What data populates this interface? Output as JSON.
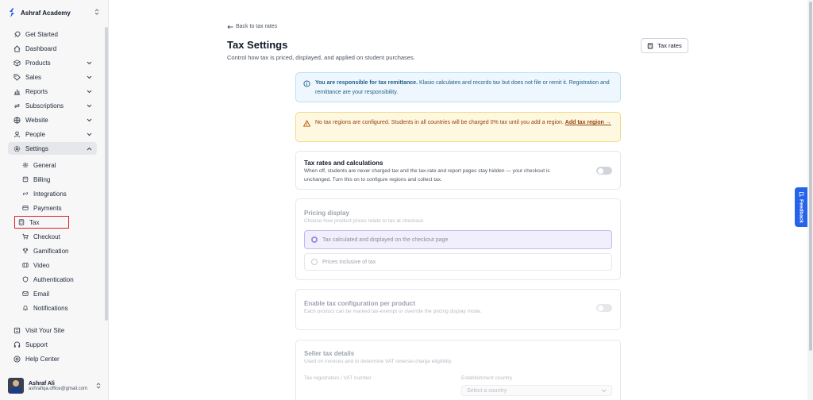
{
  "sidebar": {
    "brand": "Ashraf Academy",
    "items": [
      {
        "label": "Get Started"
      },
      {
        "label": "Dashboard"
      },
      {
        "label": "Products"
      },
      {
        "label": "Sales"
      },
      {
        "label": "Reports"
      },
      {
        "label": "Subscriptions"
      },
      {
        "label": "Website"
      },
      {
        "label": "People"
      },
      {
        "label": "Settings"
      }
    ],
    "settings_sub": [
      {
        "label": "General"
      },
      {
        "label": "Billing"
      },
      {
        "label": "Integrations"
      },
      {
        "label": "Payments"
      },
      {
        "label": "Tax"
      },
      {
        "label": "Checkout"
      },
      {
        "label": "Gamification"
      },
      {
        "label": "Video"
      },
      {
        "label": "Authentication"
      },
      {
        "label": "Email"
      },
      {
        "label": "Notifications"
      }
    ],
    "bottom": [
      {
        "label": "Visit Your Site"
      },
      {
        "label": "Support"
      },
      {
        "label": "Help Center"
      }
    ],
    "user": {
      "name": "Ashraf Ali",
      "email": "ashrafiqa.office@gmail.com"
    }
  },
  "main": {
    "back_link": "Back to tax rates",
    "title": "Tax Settings",
    "subtitle": "Control how tax is priced, displayed, and applied on student purchases.",
    "tax_rates_button": "Tax rates",
    "info": {
      "strong": "You are responsible for tax remittance.",
      "text": " Klasio calculates and records tax but does not file or remit it. Registration and remittance are your responsibility."
    },
    "warning": {
      "text": "No tax regions are configured. Students in all countries will be charged 0% tax until you add a region. ",
      "link": "Add tax region →"
    },
    "tax_calc": {
      "title": "Tax rates and calculations",
      "desc": "When off, students are never charged tax and the tax-rate and report pages stay hidden — your checkout is unchanged. Turn this on to configure regions and collect tax."
    },
    "pricing": {
      "title": "Pricing display",
      "desc": "Choose how product prices relate to tax at checkout.",
      "options": [
        {
          "label": "Tax calculated and displayed on the checkout page"
        },
        {
          "label": "Prices inclusive of tax"
        }
      ]
    },
    "per_product": {
      "title": "Enable tax configuration per product",
      "desc": "Each product can be marked tax-exempt or override the pricing display mode."
    },
    "seller": {
      "title": "Seller tax details",
      "desc": "Used on invoices and to determine VAT reverse-charge eligibility.",
      "vat_label": "Tax registration / VAT number",
      "country_label": "Establishment country",
      "country_placeholder": "Select a country"
    }
  },
  "feedback": "Feedback",
  "colors": {
    "accent": "#2563eb",
    "selected_outline": "#e11d2e",
    "info_bg": "#eef7fd",
    "warn_bg": "#fff8e1"
  }
}
